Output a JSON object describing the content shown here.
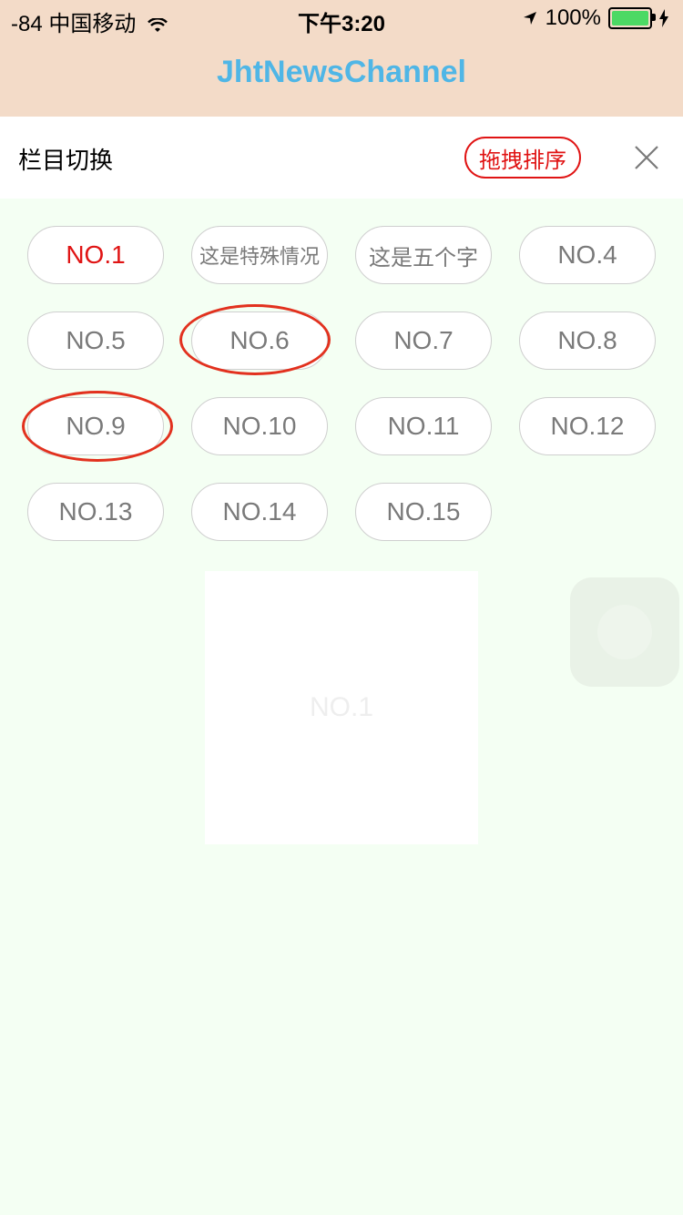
{
  "status_bar": {
    "carrier": "-84 中国移动",
    "time": "下午3:20",
    "battery": "100%"
  },
  "nav": {
    "title": "JhtNewsChannel"
  },
  "header": {
    "title": "栏目切换",
    "sort_label": "拖拽排序"
  },
  "channels": [
    "NO.1",
    "这是特殊情况",
    "这是五个字",
    "NO.4",
    "NO.5",
    "NO.6",
    "NO.7",
    "NO.8",
    "NO.9",
    "NO.10",
    "NO.11",
    "NO.12",
    "NO.13",
    "NO.14",
    "NO.15"
  ],
  "drag_preview": {
    "label": "NO.1"
  },
  "colors": {
    "accent_red": "#e01414",
    "title_blue": "#4fb6e6",
    "header_bg": "#f3dbc8",
    "content_bg": "#f4fff3"
  },
  "icons": [
    "wifi-icon",
    "location-arrow-icon",
    "battery-icon",
    "charging-icon",
    "close-icon"
  ]
}
